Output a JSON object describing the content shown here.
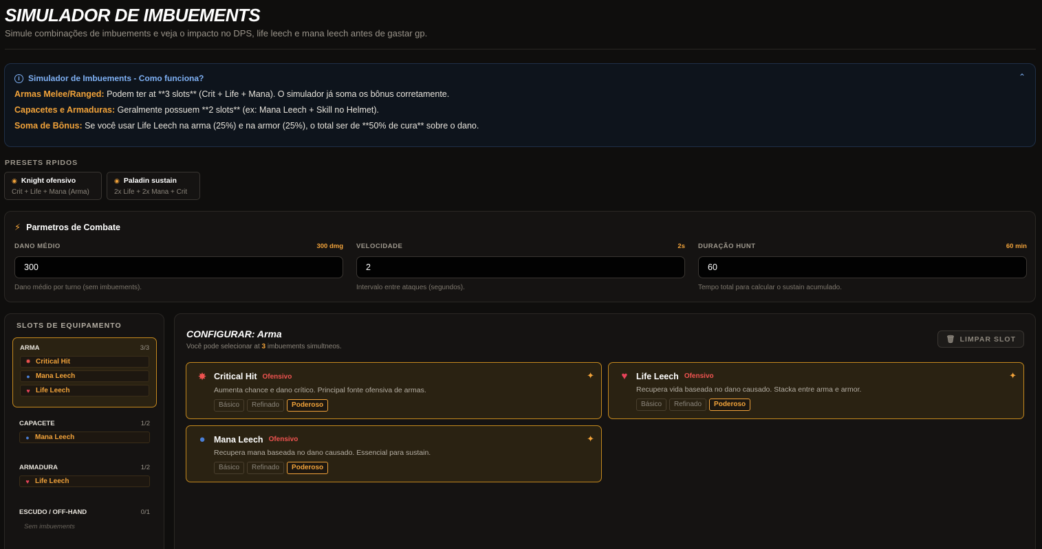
{
  "header": {
    "title": "SIMULADOR DE IMBUEMENTS",
    "subtitle": "Simule combinações de imbuements e veja o impacto no DPS, life leech e mana leech antes de gastar gp."
  },
  "info": {
    "title": "Simulador de Imbuements - Como funciona?",
    "lines": [
      {
        "label": "Armas Melee/Ranged:",
        "text": " Podem ter at **3 slots** (Crit + Life + Mana). O simulador já soma os bônus corretamente."
      },
      {
        "label": "Capacetes e Armaduras:",
        "text": " Geralmente possuem **2 slots** (ex: Mana Leech + Skill no Helmet)."
      },
      {
        "label": "Soma de Bônus:",
        "text": " Se você usar Life Leech na arma (25%) e na armor (25%), o total ser de **50% de cura** sobre o dano."
      }
    ]
  },
  "presets": {
    "label": "PRESETS RPIDOS",
    "items": [
      {
        "title": "Knight ofensivo",
        "sub": "Crit + Life + Mana (Arma)"
      },
      {
        "title": "Paladin sustain",
        "sub": "2x Life + 2x Mana + Crit"
      }
    ]
  },
  "params": {
    "title": "Parmetros de Combate",
    "fields": [
      {
        "label": "DANO MÉDIO",
        "badge": "300 dmg",
        "value": "300",
        "hint": "Dano médio por turno (sem imbuements)."
      },
      {
        "label": "VELOCIDADE",
        "badge": "2s",
        "value": "2",
        "hint": "Intervalo entre ataques (segundos)."
      },
      {
        "label": "DURAÇÃO HUNT",
        "badge": "60 min",
        "value": "60",
        "hint": "Tempo total para calcular o sustain acumulado."
      }
    ]
  },
  "slots": {
    "title": "SLOTS DE EQUIPAMENTO",
    "items": [
      {
        "name": "ARMA",
        "count": "3/3",
        "imbues": [
          "Critical Hit",
          "Mana Leech",
          "Life Leech"
        ]
      },
      {
        "name": "CAPACETE",
        "count": "1/2",
        "imbues": [
          "Mana Leech"
        ]
      },
      {
        "name": "ARMADURA",
        "count": "1/2",
        "imbues": [
          "Life Leech"
        ]
      },
      {
        "name": "ESCUDO / OFF-HAND",
        "count": "0/1",
        "empty": "Sem imbuements"
      }
    ]
  },
  "config": {
    "title": "CONFIGURAR: Arma",
    "sub_prefix": "Você pode selecionar at ",
    "sub_count": "3",
    "sub_suffix": " imbuements simultneos.",
    "clear": "LIMPAR SLOT",
    "cards": [
      {
        "name": "Critical Hit",
        "tag": "Ofensivo",
        "desc": "Aumenta chance e dano crítico. Principal fonte ofensiva de armas.",
        "icon": "burst-icon"
      },
      {
        "name": "Life Leech",
        "tag": "Ofensivo",
        "desc": "Recupera vida baseada no dano causado. Stacka entre arma e armor.",
        "icon": "heart-icon"
      },
      {
        "name": "Mana Leech",
        "tag": "Ofensivo",
        "desc": "Recupera mana baseada no dano causado. Essencial para sustain.",
        "icon": "orb-icon"
      }
    ],
    "tiers": [
      "Básico",
      "Refinado",
      "Poderoso"
    ],
    "selected_tier": "Poderoso"
  },
  "colors": {
    "accent": "#f2a33a",
    "info": "#7fb1f5",
    "tag": "#ef5350"
  }
}
